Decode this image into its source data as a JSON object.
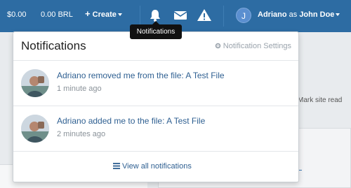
{
  "navbar": {
    "balance_usd": "$0.00",
    "balance_brl": "0.00 BRL",
    "create_label": "Create",
    "icons": [
      "plus-icon",
      "bell-icon",
      "envelope-icon",
      "warning-icon"
    ],
    "user_initial": "J",
    "user_name": "Adriano",
    "user_as": "as",
    "user_impersonated": "John Doe"
  },
  "tooltip": {
    "text": "Notifications"
  },
  "background": {
    "mark_read_text": "Mark site read"
  },
  "notifications": {
    "title": "Notifications",
    "settings_label": "Notification Settings",
    "items": [
      {
        "text": "Adriano removed me from the file: A Test File",
        "time": "1 minute ago"
      },
      {
        "text": "Adriano added me to the file: A Test File",
        "time": "2 minutes ago"
      }
    ],
    "view_all_label": "View all notifications"
  },
  "colors": {
    "navbar": "#2d6ca3",
    "link": "#2e5f91",
    "muted": "#9aa3ac",
    "tooltip": "#111111"
  }
}
